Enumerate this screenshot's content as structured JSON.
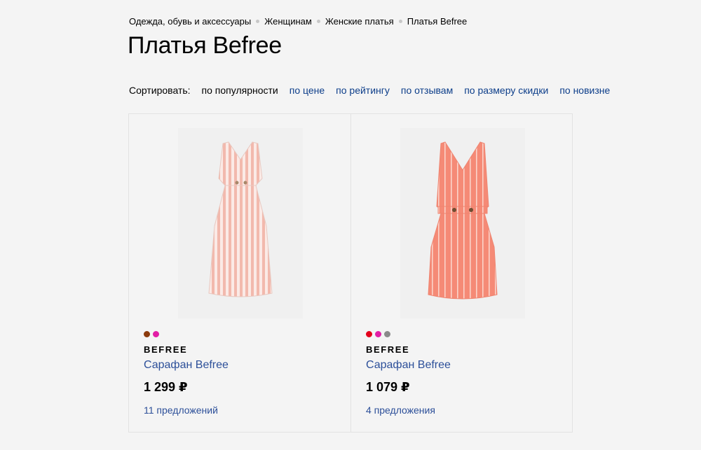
{
  "breadcrumb": {
    "items": [
      "Одежда, обувь и аксессуары",
      "Женщинам",
      "Женские платья",
      "Платья Befree"
    ]
  },
  "title": "Платья Befree",
  "sort": {
    "label": "Сортировать:",
    "options": [
      "по популярности",
      "по цене",
      "по рейтингу",
      "по отзывам",
      "по размеру скидки",
      "по новизне"
    ],
    "active": "по популярности"
  },
  "products": [
    {
      "image_icon": "striped-midi-dress-image",
      "colors": [
        "#8b3a0c",
        "#e21ea6"
      ],
      "brand": "BEFREE",
      "name": "Сарафан Befree",
      "price": "1 299 ₽",
      "offers": "11 предложений"
    },
    {
      "image_icon": "striped-pinafore-dress-image",
      "colors": [
        "#e3001b",
        "#e21ea6",
        "#8a8a8a"
      ],
      "brand": "BEFREE",
      "name": "Сарафан Befree",
      "price": "1 079 ₽",
      "offers": "4 предложения"
    }
  ],
  "colors": {
    "link": "#2c4f99",
    "sort_link": "#0d3e8a",
    "background": "#f4f4f4",
    "border": "#e2e2e2"
  }
}
